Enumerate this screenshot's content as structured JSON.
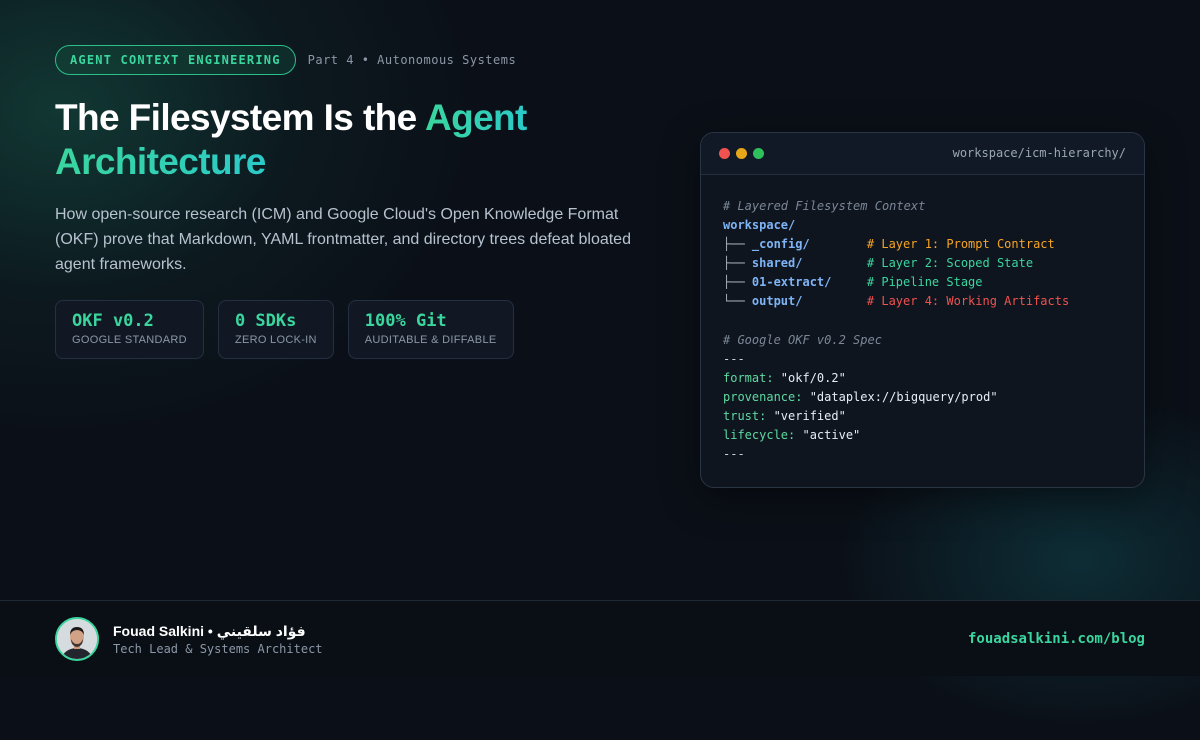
{
  "badge": {
    "label": "AGENT CONTEXT ENGINEERING",
    "part": "Part 4 • Autonomous Systems"
  },
  "title": {
    "line1": "The Filesystem Is the ",
    "accent1": "Agent",
    "accent2": "Architecture"
  },
  "subtitle": "How open-source research (ICM) and Google Cloud's Open Knowledge Format (OKF) prove that Markdown, YAML frontmatter, and directory trees defeat bloated agent frameworks.",
  "stats": [
    {
      "value": "OKF v0.2",
      "label": "GOOGLE STANDARD"
    },
    {
      "value": "0 SDKs",
      "label": "ZERO LOCK-IN"
    },
    {
      "value": "100% Git",
      "label": "AUDITABLE & DIFFABLE"
    }
  ],
  "terminal": {
    "path": "workspace/icm-hierarchy/",
    "comment1": "# Layered Filesystem Context",
    "root": "workspace/",
    "tree": [
      {
        "prefix": "├── ",
        "dir": "_config/",
        "comment": "# Layer 1: Prompt Contract",
        "color": "#f5a524"
      },
      {
        "prefix": "├── ",
        "dir": "shared/",
        "comment": "# Layer 2: Scoped State",
        "color": "#3ad69e"
      },
      {
        "prefix": "├── ",
        "dir": "01-extract/",
        "comment": "# Pipeline Stage",
        "color": "#3ad69e"
      },
      {
        "prefix": "└── ",
        "dir": "output/",
        "comment": "# Layer 4: Working Artifacts",
        "color": "#f0524f"
      }
    ],
    "comment2": "# Google OKF v0.2 Spec",
    "sep": "---",
    "yaml": [
      {
        "key": "format:",
        "value": " \"okf/0.2\""
      },
      {
        "key": "provenance:",
        "value": " \"dataplex://bigquery/prod\""
      },
      {
        "key": "trust:",
        "value": " \"verified\""
      },
      {
        "key": "lifecycle:",
        "value": " \"active\""
      }
    ]
  },
  "footer": {
    "name": "Fouad Salkini • فؤاد سلقيني",
    "role": "Tech Lead & Systems Architect",
    "blog": "fouadsalkini.com/blog"
  }
}
